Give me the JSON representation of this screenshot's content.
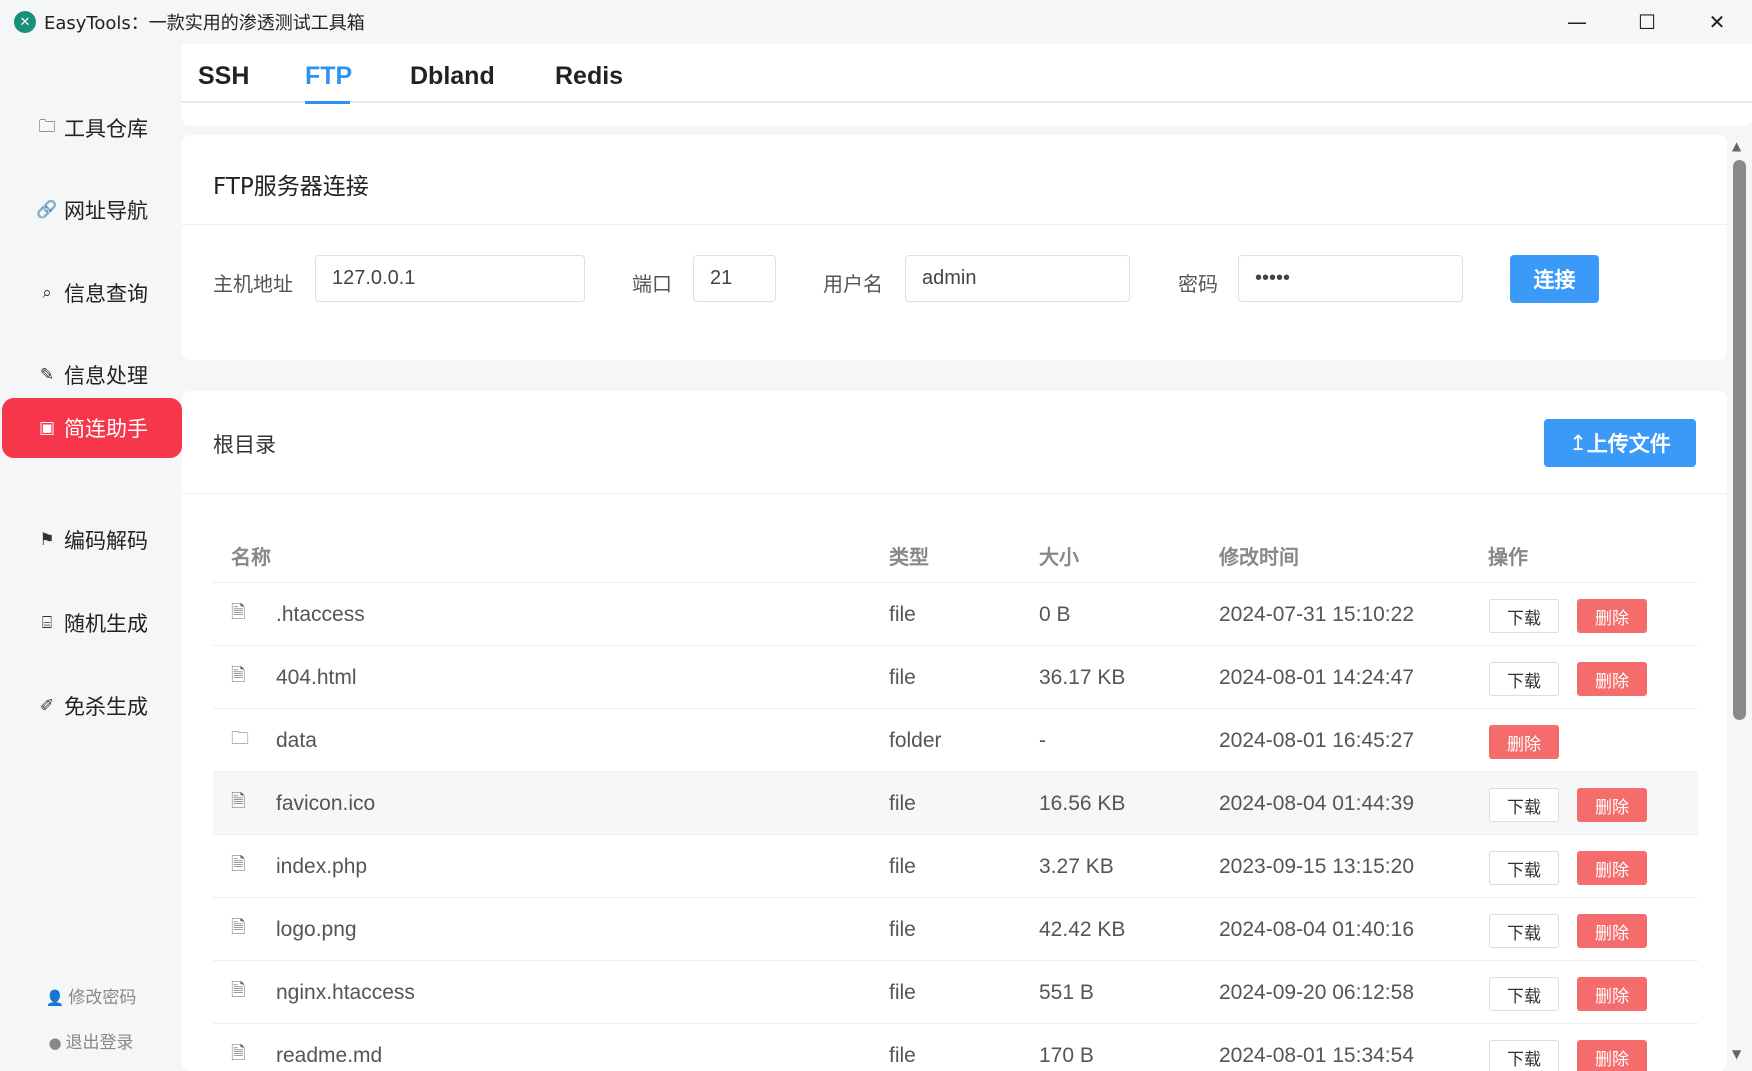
{
  "window": {
    "title": "EasyTools：一款实用的渗透测试工具箱",
    "minimize": "—",
    "maximize": "☐",
    "close": "✕"
  },
  "sidebar": {
    "items": [
      {
        "label": "工具仓库",
        "icon": "🗀"
      },
      {
        "label": "网址导航",
        "icon": "🔗"
      },
      {
        "label": "信息查询",
        "icon": "⌕"
      },
      {
        "label": "信息处理",
        "icon": "✎"
      },
      {
        "label": "简连助手",
        "icon": "▣"
      },
      {
        "label": "编码解码",
        "icon": "⚑"
      },
      {
        "label": "随机生成",
        "icon": "⌸"
      },
      {
        "label": "免杀生成",
        "icon": "✐"
      }
    ],
    "active_index": 4,
    "change_password": "修改密码",
    "logout": "退出登录"
  },
  "tabs": [
    "SSH",
    "FTP",
    "Dbland",
    "Redis"
  ],
  "active_tab": "FTP",
  "connection": {
    "title": "FTP服务器连接",
    "host_label": "主机地址",
    "host_value": "127.0.0.1",
    "port_label": "端口",
    "port_value": "21",
    "user_label": "用户名",
    "user_value": "admin",
    "pass_label": "密码",
    "pass_value": "•••••",
    "connect_button": "连接"
  },
  "files": {
    "title": "根目录",
    "upload_button": "上传文件",
    "upload_icon": "↥",
    "columns": {
      "name": "名称",
      "type": "类型",
      "size": "大小",
      "mtime": "修改时间",
      "actions": "操作"
    },
    "download_label": "下载",
    "delete_label": "删除",
    "rows": [
      {
        "name": ".htaccess",
        "type": "file",
        "size": "0 B",
        "mtime": "2024-07-31 15:10:22"
      },
      {
        "name": "404.html",
        "type": "file",
        "size": "36.17 KB",
        "mtime": "2024-08-01 14:24:47"
      },
      {
        "name": "data",
        "type": "folder",
        "size": "-",
        "mtime": "2024-08-01 16:45:27"
      },
      {
        "name": "favicon.ico",
        "type": "file",
        "size": "16.56 KB",
        "mtime": "2024-08-04 01:44:39"
      },
      {
        "name": "index.php",
        "type": "file",
        "size": "3.27 KB",
        "mtime": "2023-09-15 13:15:20"
      },
      {
        "name": "logo.png",
        "type": "file",
        "size": "42.42 KB",
        "mtime": "2024-08-04 01:40:16"
      },
      {
        "name": "nginx.htaccess",
        "type": "file",
        "size": "551 B",
        "mtime": "2024-09-20 06:12:58"
      },
      {
        "name": "readme.md",
        "type": "file",
        "size": "170 B",
        "mtime": "2024-08-01 15:34:54"
      }
    ]
  },
  "colors": {
    "accent": "#3b99f7",
    "active_nav": "#f5364b",
    "danger": "#f56c6c"
  }
}
